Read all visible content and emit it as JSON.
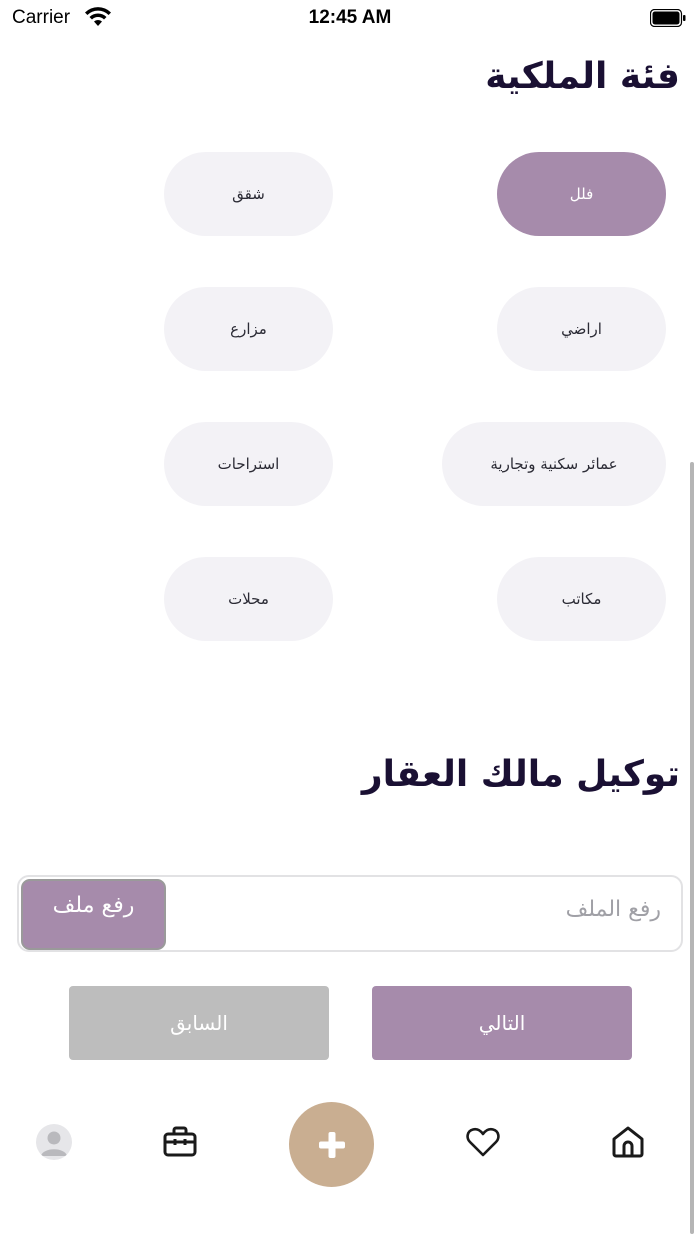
{
  "status_bar": {
    "carrier": "Carrier",
    "time": "12:45 AM"
  },
  "property_category": {
    "title": "فئة الملكية",
    "selected": "فلل",
    "options": [
      "فلل",
      "شقق",
      "اراضي",
      "مزارع",
      "عمائر سكنية وتجارية",
      "استراحات",
      "مكاتب",
      "محلات"
    ]
  },
  "owner_authorization": {
    "title": "توكيل مالك العقار",
    "file_placeholder": "رفع الملف",
    "upload_label": "رفع ملف"
  },
  "navigation": {
    "next_label": "التالي",
    "previous_label": "السابق"
  },
  "tab_bar": {
    "icons": [
      "profile-avatar-icon",
      "briefcase-icon",
      "add-icon",
      "heart-icon",
      "home-icon"
    ]
  },
  "colors": {
    "accent": "#a68bab",
    "add_button": "#c9ae91",
    "chip_background": "#f3f2f6",
    "disabled_button": "#bdbdbd",
    "title_text": "#1a1033"
  }
}
